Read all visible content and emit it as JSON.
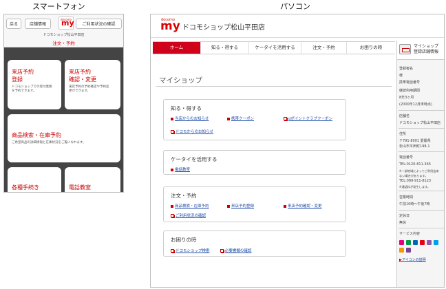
{
  "captions": {
    "phone": "スマートフォン",
    "pc": "パソコン"
  },
  "phone": {
    "buttons": [
      "戻る",
      "店舗情報",
      "ご利用状況の確認"
    ],
    "logo": {
      "small": "docomo",
      "big": "my"
    },
    "shop_name": "ドコモショップ松山平田店",
    "order_label": "注文・予約",
    "cards": [
      {
        "title": "来店予約登録",
        "lines": [
          "来店予約",
          "登録"
        ],
        "desc": [
          "ドコモショップでの受付業務",
          "を予約できます。"
        ]
      },
      {
        "title": "来店予約確認・変更",
        "lines": [
          "来店予約",
          "確認・変更"
        ],
        "desc": [
          "来店予約の予約確認や予約変",
          "更ができます。"
        ]
      },
      {
        "title": "商品検索・在庫予約",
        "lines": [
          "商品検索・在庫予約"
        ],
        "desc": [
          "ご希望商品の詳細情報と在庫状況をご覧になれます。"
        ]
      },
      {
        "title": "各種手続き",
        "lines": [
          "各種手続き"
        ],
        "desc": []
      },
      {
        "title": "電話教室",
        "lines": [
          "電話教室"
        ],
        "desc": []
      }
    ]
  },
  "pc": {
    "logo": {
      "small": "docomo",
      "big": "my"
    },
    "title": "ドコモショップ松山平田店",
    "nav": [
      "ホーム",
      "知る・得する",
      "ケータイを活用する",
      "注文・予約",
      "お困りの時"
    ],
    "myshop": "マイショップ",
    "sections": [
      {
        "heading": "知る・得する",
        "links": [
          "当店からのお知らせ",
          "携帯クーポン",
          "dポイントクラブクーポン",
          "ドコモからのお知らせ"
        ]
      },
      {
        "heading": "ケータイを活用する",
        "links": [
          "電話教室"
        ]
      },
      {
        "heading": "注文・予約",
        "links": [
          "商品検索・在庫予約",
          "来店予約登録",
          "来店予約確認・変更",
          "ご利用状況の確認"
        ]
      },
      {
        "heading": "お困りの時",
        "links": [
          "ドコモショップ検索",
          "必要書類の確認"
        ]
      }
    ],
    "side": {
      "title1": "マイショップ",
      "title2": "登録店舗情報",
      "fields": [
        {
          "label": "登録者名",
          "value": "様"
        },
        {
          "label": "携帯電話番号",
          "value": ""
        },
        {
          "label": "継続利用期間",
          "value": "8年3ヶ月"
        },
        {
          "label": "",
          "value": "(2000年12月末時点)"
        },
        {
          "label": "店舗名",
          "value": "ドコモショップ松山平田店"
        },
        {
          "label": "住所",
          "value": "〒791-8001 愛媛県"
        },
        {
          "label": "",
          "value": "松山市平田町198-1"
        },
        {
          "label": "電話番号",
          "value": "TEL:0120-811-345"
        },
        {
          "label": "",
          "value": "※一部地域によってご利用出来"
        },
        {
          "label": "",
          "value": "ない場合があります。"
        },
        {
          "label": "",
          "value": "TEL:089-911-8123"
        },
        {
          "label": "",
          "value": "※通話料が発生します。"
        },
        {
          "label": "営業時間",
          "value": "午前10時～午後7時"
        },
        {
          "label": "定休日",
          "value": "無休"
        },
        {
          "label": "サービス内容",
          "value": ""
        }
      ],
      "icon_link": "アイコンの説明",
      "service_colors": [
        "#e4007f",
        "#009944",
        "#0068b7",
        "#e60012",
        "#8f5ba6",
        "#00a0e9",
        "#f39800",
        "#7d3f98"
      ]
    }
  }
}
